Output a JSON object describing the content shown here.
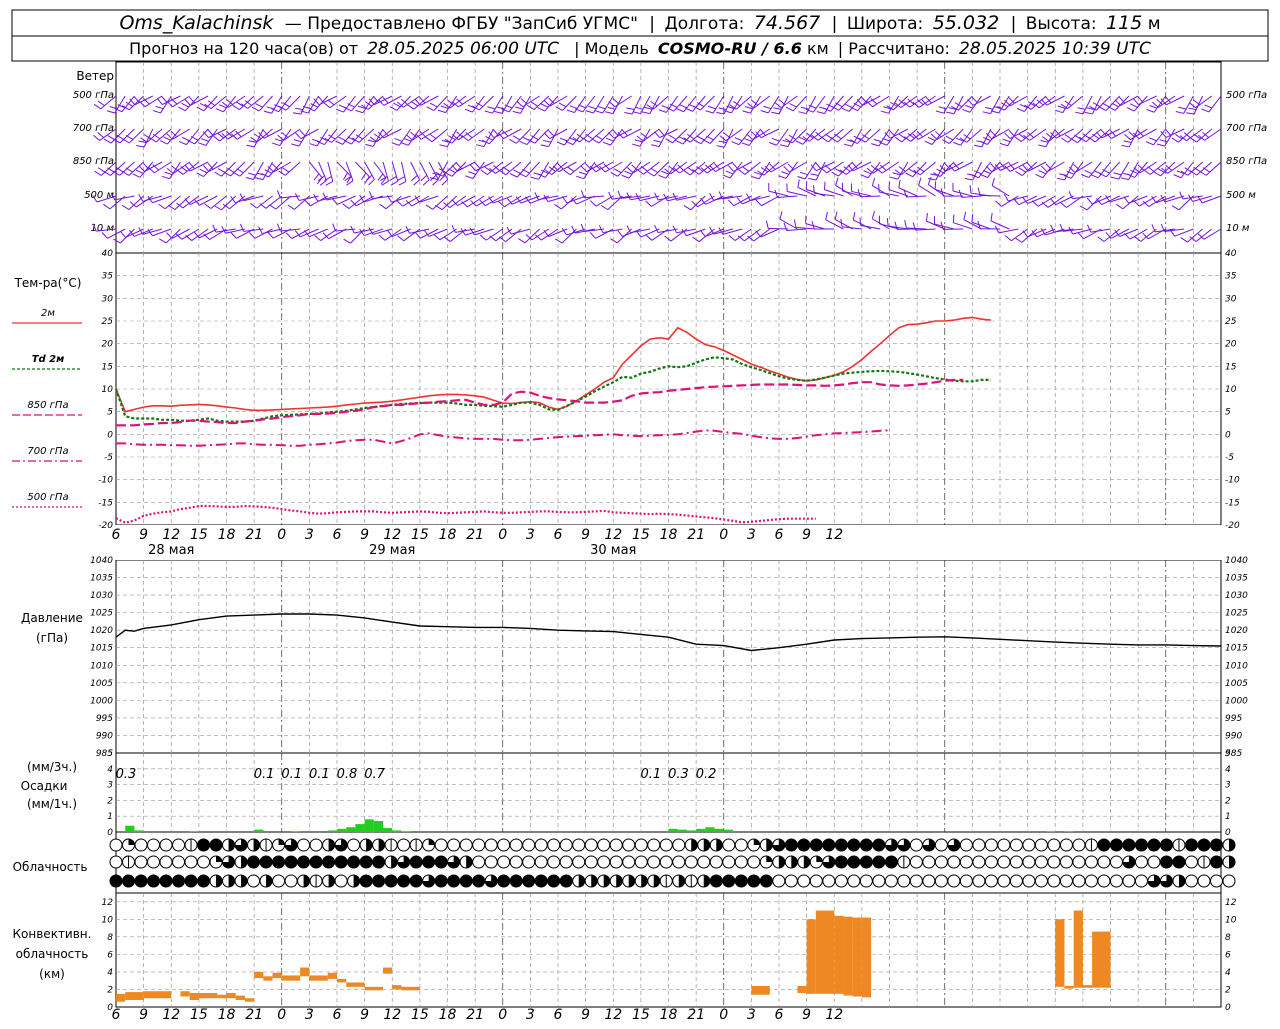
{
  "header": {
    "station": "Oms_Kalachinsk",
    "provider": "— Предоставлено ФГБУ \"ЗапСиб УГМС\"",
    "lon_label": "Долгота:",
    "lon": "74.567",
    "lat_label": "Широта:",
    "lat": "55.032",
    "alt_label": "Высота:",
    "alt": "115",
    "alt_unit": "м",
    "forecast_label": "Прогноз на 120 часа(ов) от",
    "forecast_time": "28.05.2025 06:00 UTC",
    "model_label": "| Модель",
    "model": "COSMO-RU / 6.6",
    "model_unit": "км",
    "calc_label": "| Рассчитано:",
    "calc_time": "28.05.2025 10:39 UTC"
  },
  "panels": {
    "wind": {
      "title": "Ветер",
      "levels": [
        "500 гПа",
        "700 гПа",
        "850 гПа",
        "500 м",
        "10 м"
      ]
    },
    "temp": {
      "title": "Тем-ра(°C)",
      "legend": [
        {
          "label": "2м",
          "color": "#ee3333"
        },
        {
          "label": "Td  2м",
          "color": "#117711"
        },
        {
          "label": "850 гПа",
          "color": "#dd1177"
        },
        {
          "label": "700 гПа",
          "color": "#dd1177"
        },
        {
          "label": "500 гПа",
          "color": "#dd1177"
        }
      ]
    },
    "pressure": {
      "title1": "Давление",
      "title2": "(гПа)"
    },
    "precip": {
      "title1": "(мм/3ч.)",
      "title2": "Осадки",
      "title3": "(мм/1ч.)"
    },
    "cloud": {
      "title": "Облачность"
    },
    "conv": {
      "title1": "Конвективн.",
      "title2": "облачность",
      "title3": "(км)"
    }
  },
  "x_ticks": [
    "6",
    "9",
    "12",
    "15",
    "18",
    "21",
    "0",
    "3",
    "6",
    "9",
    "12",
    "15",
    "18",
    "21",
    "0",
    "3",
    "6",
    "9",
    "12",
    "15",
    "18",
    "21",
    "0",
    "3",
    "6",
    "9",
    "12"
  ],
  "day_labels": [
    "28 мая",
    "29 мая",
    "30 мая"
  ],
  "colors": {
    "t2m": "#ee3333",
    "td": "#117711",
    "t850": "#dd1177",
    "wind": "#7711dd",
    "precip": "#22cc22",
    "conv": "#ee8822",
    "grid": "#999999"
  },
  "chart_data": [
    {
      "type": "line",
      "title": "Тем-ра(°C)",
      "x_hours": [
        6,
        7,
        8,
        9,
        10,
        11,
        12,
        13,
        14,
        15,
        16,
        17,
        18,
        19,
        20,
        21,
        22,
        23,
        24,
        25,
        26,
        27,
        28,
        29,
        30,
        31,
        32,
        33,
        34,
        35,
        36,
        37,
        38,
        39,
        40,
        41,
        42,
        43,
        44,
        45,
        46,
        47,
        48,
        49,
        50,
        51,
        52,
        53,
        54,
        55,
        56,
        57,
        58,
        59,
        60,
        61,
        62,
        63,
        64,
        65,
        66,
        67,
        68,
        69,
        70,
        71,
        72,
        73,
        74,
        75,
        76,
        77,
        78,
        79,
        80,
        81,
        82,
        83,
        84,
        85,
        86,
        87,
        88,
        89,
        90,
        91,
        92,
        93,
        94,
        95,
        96,
        97,
        98,
        99,
        100,
        101,
        102,
        103,
        104,
        105,
        106,
        107,
        108,
        109,
        110,
        111,
        112,
        113,
        114,
        115,
        116,
        117,
        118,
        119,
        120,
        121,
        122,
        123,
        124,
        125,
        126
      ],
      "ylim": [
        -20,
        40
      ],
      "series": [
        {
          "name": "2м",
          "values": [
            10,
            5,
            5.5,
            6,
            6.3,
            6.3,
            6.2,
            6.4,
            6.5,
            6.6,
            6.5,
            6.3,
            6,
            5.8,
            5.5,
            5.3,
            5.3,
            5.4,
            5.5,
            5.6,
            5.7,
            5.8,
            5.9,
            6,
            6.2,
            6.5,
            6.7,
            6.9,
            7,
            7.1,
            7.3,
            7.6,
            7.9,
            8.2,
            8.5,
            8.7,
            8.8,
            8.8,
            8.7,
            8.5,
            8.2,
            7.5,
            6.9,
            6.8,
            7,
            7.2,
            7,
            6,
            5.5,
            6.2,
            7.4,
            8.7,
            10,
            11.5,
            12.5,
            15.5,
            17.5,
            19.5,
            21,
            21.3,
            21,
            23.5,
            22.5,
            21,
            19.8,
            19.3,
            18.5,
            17.5,
            16.5,
            15.5,
            14.8,
            14,
            13.3,
            12.6,
            12.1,
            11.8,
            12,
            12.5,
            13,
            13.8,
            15,
            16.5,
            18.3,
            20,
            21.8,
            23.5,
            24.2,
            24.3,
            24.6,
            25,
            25,
            25.2,
            25.6,
            25.8,
            25.4,
            25.2
          ]
        },
        {
          "name": "Td 2м",
          "values": [
            10,
            4,
            3.5,
            3.5,
            3.5,
            3.2,
            3.2,
            3,
            3,
            3.2,
            3.5,
            3,
            2.8,
            2.8,
            2.8,
            3,
            3.5,
            4,
            4.2,
            4.3,
            4.4,
            4.5,
            4.6,
            4.8,
            5,
            5.2,
            5.5,
            5.8,
            6,
            6.3,
            6.5,
            6.7,
            6.8,
            6.9,
            7,
            7,
            7,
            6.8,
            6.5,
            6.5,
            6.3,
            6.2,
            6.1,
            6.5,
            7,
            7,
            6.5,
            5.5,
            5.4,
            6.3,
            7.3,
            8.3,
            9.5,
            10.5,
            11.5,
            12.7,
            12.5,
            13.4,
            13.8,
            14.5,
            15,
            14.8,
            15,
            15.8,
            16.5,
            17,
            16.8,
            16.5,
            15.5,
            14.8,
            14.2,
            13.5,
            12.8,
            12.3,
            12,
            11.8,
            12.1,
            12.5,
            13,
            13.4,
            13.6,
            13.8,
            13.9,
            14,
            13.9,
            13.8,
            13.5,
            13.2,
            12.8,
            12.4,
            12.1,
            11.8,
            11.7,
            11.7,
            12,
            12
          ]
        },
        {
          "name": "850 гПа",
          "values": [
            2,
            2,
            2,
            2.2,
            2.3,
            2.5,
            2.5,
            2.7,
            3,
            3,
            2.8,
            2.7,
            2.5,
            2.5,
            2.8,
            3,
            3.3,
            3.5,
            3.8,
            4,
            4.2,
            4.5,
            4.5,
            4.6,
            4.7,
            5,
            5.2,
            5.5,
            6,
            6.2,
            6.5,
            6.5,
            6.7,
            6.9,
            7,
            7.2,
            7.3,
            7.5,
            7.6,
            7,
            6.5,
            6.5,
            7,
            9,
            9.4,
            9.2,
            8.5,
            8,
            7.7,
            7.5,
            7.3,
            7,
            7,
            7,
            7.2,
            7.5,
            8.5,
            9,
            9.2,
            9.3,
            9.6,
            9.8,
            10,
            10.2,
            10.4,
            10.5,
            10.6,
            10.7,
            10.8,
            10.9,
            11,
            11,
            11,
            11,
            10.9,
            10.8,
            10.8,
            10.7,
            10.8,
            11,
            11.3,
            11.5,
            11.5,
            11,
            10.8,
            10.7,
            10.8,
            11,
            11.2,
            11.5,
            11.8,
            12,
            12
          ]
        },
        {
          "name": "700 гПа",
          "values": [
            -2,
            -2,
            -2.2,
            -2.3,
            -2.3,
            -2.3,
            -2.4,
            -2.4,
            -2.5,
            -2.5,
            -2.4,
            -2.3,
            -2.2,
            -2,
            -2,
            -2.2,
            -2.3,
            -2.3,
            -2.4,
            -2.5,
            -2.5,
            -2.3,
            -2.2,
            -2,
            -1.8,
            -1.5,
            -1.3,
            -1.2,
            -1.2,
            -1.6,
            -2,
            -1.5,
            -0.8,
            0,
            0.2,
            -0.2,
            -0.5,
            -0.7,
            -0.9,
            -1,
            -1,
            -1,
            -1.2,
            -1.3,
            -1.3,
            -1.2,
            -1,
            -0.8,
            -0.6,
            -0.5,
            -0.4,
            -0.3,
            -0.2,
            -0.1,
            0,
            -0.2,
            -0.3,
            -0.4,
            -0.3,
            -0.2,
            -0.1,
            0,
            0.3,
            0.6,
            0.9,
            0.8,
            0.5,
            0.3,
            0.1,
            -0.3,
            -0.6,
            -0.9,
            -1,
            -1,
            -0.8,
            -0.5,
            -0.2,
            0,
            0.2,
            0.3,
            0.4,
            0.5,
            0.6,
            0.8,
            0.9
          ]
        },
        {
          "name": "500 гПа",
          "values": [
            -18.5,
            -19.5,
            -19,
            -18,
            -17.5,
            -17.2,
            -17,
            -16.5,
            -16.2,
            -15.8,
            -15.8,
            -15.9,
            -16,
            -16,
            -15.8,
            -15.9,
            -16,
            -16.2,
            -16.5,
            -16.8,
            -17,
            -17.3,
            -17.5,
            -17.4,
            -17.2,
            -17.1,
            -17,
            -17,
            -17,
            -17.2,
            -17.3,
            -17.2,
            -17.1,
            -17,
            -17.1,
            -17.3,
            -17.4,
            -17.3,
            -17.2,
            -17.1,
            -17,
            -17.2,
            -17.3,
            -17.3,
            -17.2,
            -17.1,
            -17,
            -17,
            -17.1,
            -17.2,
            -17.2,
            -17.1,
            -17,
            -16.9,
            -17.2,
            -17.3,
            -17.4,
            -17.5,
            -17.6,
            -17.5,
            -17.6,
            -17.7,
            -17.9,
            -18.1,
            -18.3,
            -18.5,
            -18.8,
            -19.1,
            -19.4,
            -19.3,
            -19.1,
            -18.9,
            -18.7,
            -18.6,
            -18.6,
            -18.6,
            -18.6
          ]
        }
      ]
    },
    {
      "type": "line",
      "title": "Давление (гПа)",
      "ylim": [
        985,
        1040
      ],
      "x_hours": [
        6,
        7,
        8,
        9,
        12,
        15,
        18,
        21,
        24,
        27,
        30,
        33,
        36,
        39,
        42,
        45,
        48,
        51,
        54,
        57,
        60,
        63,
        66,
        69,
        72,
        75,
        78,
        81,
        84,
        87,
        90,
        93,
        96,
        99,
        102,
        105,
        108,
        111,
        114,
        117,
        120,
        123,
        126
      ],
      "series": [
        {
          "name": "Давление",
          "values": [
            1018,
            1020,
            1019.7,
            1020.5,
            1021.5,
            1023,
            1024,
            1024.3,
            1024.6,
            1024.6,
            1024.3,
            1023.5,
            1022.3,
            1021.2,
            1021,
            1020.8,
            1020.8,
            1020.5,
            1020,
            1019.8,
            1019.6,
            1018.8,
            1018,
            1016,
            1015.6,
            1014.2,
            1015,
            1016,
            1017.2,
            1017.6,
            1017.8,
            1018,
            1018.1,
            1017.8,
            1017.4,
            1017,
            1016.6,
            1016.3,
            1016,
            1015.8,
            1015.8,
            1015.6,
            1015.5
          ]
        }
      ]
    },
    {
      "type": "bar",
      "title": "Осадки",
      "series": [
        {
          "name": "мм/3ч.",
          "x_hours": [
            6,
            21,
            24,
            27,
            30,
            33,
            36,
            63,
            66,
            69
          ],
          "values": [
            0.3,
            0.1,
            0.1,
            0.1,
            0.8,
            0.7,
            0.3,
            0.1,
            0.3,
            0.2
          ]
        },
        {
          "name": "мм/1ч.",
          "x_hours": [
            7,
            8,
            14,
            21,
            25,
            29,
            30,
            31,
            32,
            33,
            34,
            35,
            36,
            37,
            66,
            67,
            68,
            69,
            70,
            71,
            72,
            107,
            109
          ],
          "values": [
            0.4,
            0.1,
            0.05,
            0.15,
            0.05,
            0.1,
            0.2,
            0.3,
            0.5,
            0.8,
            0.7,
            0.25,
            0.1,
            0.05,
            0.2,
            0.15,
            0.1,
            0.2,
            0.3,
            0.2,
            0.15,
            0.05,
            0.05
          ]
        }
      ]
    },
    {
      "type": "bar",
      "title": "Конвективн. облачность (км)",
      "ylim": [
        0,
        13
      ],
      "series": [
        {
          "name": "Конвективн. облачность",
          "ranges": [
            [
              6,
              7,
              0.6,
              1.5
            ],
            [
              7,
              9,
              0.8,
              1.7
            ],
            [
              9,
              11,
              1,
              1.8
            ],
            [
              11,
              12,
              1,
              1.8
            ],
            [
              13,
              14,
              1.2,
              1.8
            ],
            [
              14,
              15,
              0.8,
              1.6
            ],
            [
              15,
              17,
              1,
              1.6
            ],
            [
              17,
              18,
              1,
              1.4
            ],
            [
              18,
              19,
              1,
              1.6
            ],
            [
              19,
              20,
              0.8,
              1.3
            ],
            [
              20,
              21,
              0.6,
              1
            ],
            [
              21,
              22,
              3.3,
              4
            ],
            [
              22,
              23,
              3,
              3.5
            ],
            [
              23,
              24,
              3.3,
              3.9
            ],
            [
              24,
              26,
              3,
              3.6
            ],
            [
              26,
              27,
              3.5,
              4.5
            ],
            [
              27,
              29,
              3,
              3.6
            ],
            [
              29,
              30,
              3.2,
              3.9
            ],
            [
              30,
              31,
              2.8,
              3.2
            ],
            [
              31,
              33,
              2.3,
              2.8
            ],
            [
              33,
              35,
              1.9,
              2.3
            ],
            [
              35,
              36,
              3.8,
              4.5
            ],
            [
              36,
              37,
              2,
              2.5
            ],
            [
              37,
              39,
              1.9,
              2.3
            ],
            [
              75,
              77,
              1.4,
              2.4
            ],
            [
              80,
              81,
              1.6,
              2.4
            ],
            [
              81,
              82,
              1.5,
              10
            ],
            [
              82,
              84,
              1.5,
              11
            ],
            [
              84,
              85,
              1.5,
              10.4
            ],
            [
              85,
              86,
              1.3,
              10.3
            ],
            [
              86,
              87,
              1.2,
              10.2
            ],
            [
              87,
              88,
              1.1,
              10.2
            ],
            [
              108,
              109,
              2.3,
              10
            ],
            [
              109,
              110,
              2.1,
              2.4
            ],
            [
              110,
              111,
              2.2,
              11
            ],
            [
              111,
              112,
              2.2,
              2.5
            ],
            [
              112,
              114,
              2.2,
              8.6
            ]
          ]
        }
      ]
    }
  ],
  "precip_labels": [
    {
      "x": 6,
      "v": "0.3"
    },
    {
      "x": 21,
      "v": "0.1"
    },
    {
      "x": 24,
      "v": "0.1"
    },
    {
      "x": 27,
      "v": "0.1"
    },
    {
      "x": 30,
      "v": "0.8"
    },
    {
      "x": 33,
      "v": "0.7"
    },
    {
      "x": 63,
      "v": "0.1"
    },
    {
      "x": 66,
      "v": "0.3"
    },
    {
      "x": 69,
      "v": "0.2"
    }
  ],
  "cloud_rows": [
    "0r00001bbh3h1r300h30hh101r00000000000000000000hhh00rh3bbbbbbbb33030300000000001bbbbbb1bbbh",
    "01000000r3hbbbbbbbbbbbh3bbb3h00000000000000000000000rhhhr3bbbbb100000000000000000300bb01bh",
    "bbbbbbbbhhh0h00h1h0hbbbbb3bbbb3bbbbbbhhhhhhh1h1hbbbbb00000000000000000000000000000033h0000"
  ]
}
